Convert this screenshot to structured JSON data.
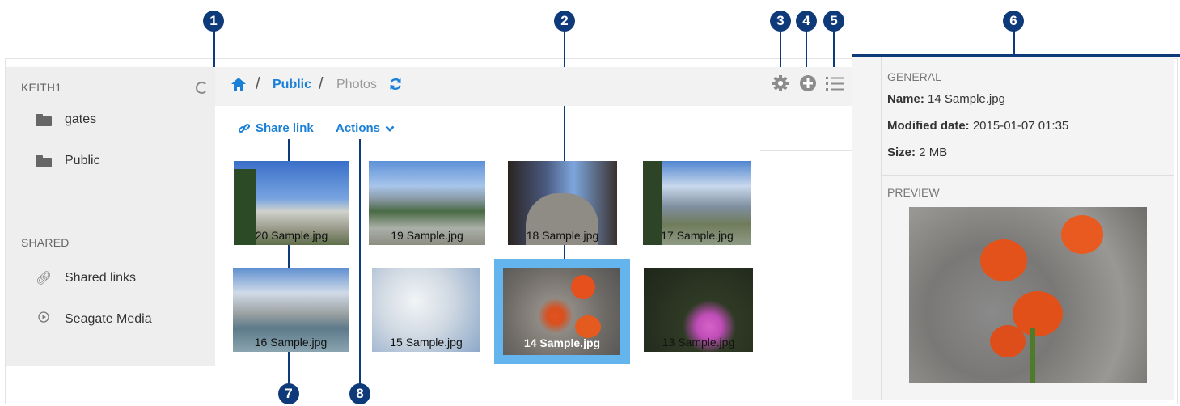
{
  "callouts": [
    "1",
    "2",
    "3",
    "4",
    "5",
    "6",
    "7",
    "8"
  ],
  "sidebar": {
    "account": "KEITH1",
    "folders": [
      {
        "icon": "folder-icon",
        "label": "gates"
      },
      {
        "icon": "folder-icon",
        "label": "Public"
      }
    ],
    "shared_heading": "SHARED",
    "shared_items": [
      {
        "icon": "link-icon",
        "label": "Shared links"
      },
      {
        "icon": "play-circle-icon",
        "label": "Seagate Media"
      }
    ]
  },
  "breadcrumb": {
    "home_icon": "home-icon",
    "separator": "/",
    "items": [
      "Public",
      "Photos"
    ],
    "refresh_icon": "refresh-icon"
  },
  "toolbar": {
    "share_link": "Share link",
    "actions": "Actions",
    "icons": [
      "gear-icon",
      "plus-circle-icon",
      "list-icon",
      "info-icon"
    ]
  },
  "thumbnails": [
    {
      "caption": "20 Sample.jpg",
      "selected": false
    },
    {
      "caption": "19 Sample.jpg",
      "selected": false
    },
    {
      "caption": "18 Sample.jpg",
      "selected": false
    },
    {
      "caption": "17 Sample.jpg",
      "selected": false
    },
    {
      "caption": "16 Sample.jpg",
      "selected": false
    },
    {
      "caption": "15 Sample.jpg",
      "selected": false
    },
    {
      "caption": "14 Sample.jpg",
      "selected": true
    },
    {
      "caption": "13 Sample.jpg",
      "selected": false
    }
  ],
  "details": {
    "general_heading": "GENERAL",
    "name_label": "Name:",
    "name_value": "14 Sample.jpg",
    "modified_label": "Modified date:",
    "modified_value": "2015-01-07 01:35",
    "size_label": "Size:",
    "size_value": "2 MB",
    "preview_heading": "PREVIEW"
  },
  "colors": {
    "accent": "#1a7fd6",
    "callout": "#0f3a7a",
    "selection": "#64b5ee"
  }
}
